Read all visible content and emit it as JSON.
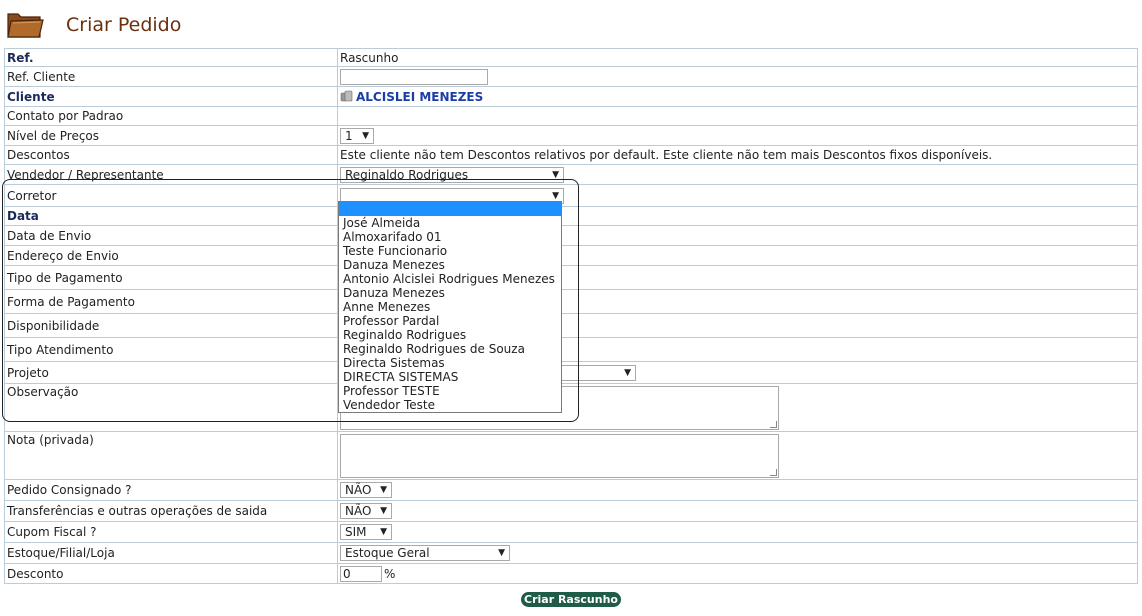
{
  "page": {
    "title": "Criar Pedido",
    "icon": "folder-icon"
  },
  "form": {
    "ref": {
      "label": "Ref.",
      "value": "Rascunho"
    },
    "ref_cliente": {
      "label": "Ref. Cliente",
      "value": ""
    },
    "cliente": {
      "label": "Cliente",
      "value": "ALCISLEI MENEZES",
      "icon": "users-icon"
    },
    "contato": {
      "label": "Contato por Padrao"
    },
    "nivel_precos": {
      "label": "Nível de Preços",
      "value": "1"
    },
    "descontos": {
      "label": "Descontos",
      "value": "Este cliente não tem Descontos relativos por default. Este cliente não tem mais Descontos fixos disponíveis."
    },
    "vendedor": {
      "label": "Vendedor / Representante",
      "value": "Reginaldo Rodrigues"
    },
    "corretor": {
      "label": "Corretor",
      "value": ""
    },
    "data": {
      "label": "Data"
    },
    "data_envio": {
      "label": "Data de Envio"
    },
    "endereco_envio": {
      "label": "Endereço de Envio"
    },
    "tipo_pagamento": {
      "label": "Tipo de Pagamento"
    },
    "forma_pagamento": {
      "label": "Forma de Pagamento"
    },
    "disponibilidade": {
      "label": "Disponibilidade"
    },
    "tipo_atendimento": {
      "label": "Tipo Atendimento"
    },
    "projeto": {
      "label": "Projeto"
    },
    "observacao": {
      "label": "Observação"
    },
    "nota": {
      "label": "Nota (privada)"
    },
    "consignado": {
      "label": "Pedido Consignado ?",
      "value": "NÃO"
    },
    "transferencias": {
      "label": "Transferências e outras operações de saida",
      "value": "NÃO"
    },
    "cupom": {
      "label": "Cupom Fiscal ?",
      "value": "SIM"
    },
    "estoque": {
      "label": "Estoque/Filial/Loja",
      "value": "Estoque Geral"
    },
    "desconto": {
      "label": "Desconto",
      "value": "0",
      "unit": "%"
    }
  },
  "corretor_options": [
    "",
    "José Almeida",
    "Almoxarifado 01",
    "Teste Funcionario",
    "Danuza Menezes",
    "Antonio Alcislei Rodrigues Menezes",
    "Danuza Menezes",
    "Anne Menezes",
    "Professor Pardal",
    "Reginaldo Rodrigues",
    "Reginaldo Rodrigues de Souza",
    "Directa Sistemas",
    "DIRECTA SISTEMAS",
    "Professor TESTE",
    "Vendedor Teste"
  ],
  "submit_label": "Criar Rascunho"
}
